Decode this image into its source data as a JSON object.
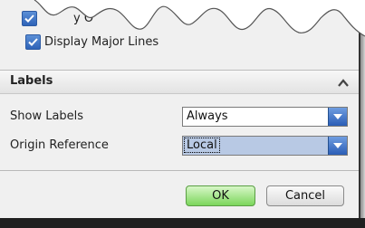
{
  "options": {
    "partial_label": "y O",
    "display_major_lines": {
      "label": "Display Major Lines",
      "checked": true
    }
  },
  "labels_section": {
    "title": "Labels",
    "collapse_icon": "chevron-up-icon",
    "show_labels": {
      "label": "Show Labels",
      "value": "Always"
    },
    "origin_reference": {
      "label": "Origin Reference",
      "value": "Local"
    }
  },
  "buttons": {
    "ok": "OK",
    "cancel": "Cancel"
  },
  "colors": {
    "checkbox": "#2e63b8",
    "dropdown_button": "#3b6fc4",
    "ok_button": "#7bd65b",
    "focused_select": "#b8c9e4"
  }
}
